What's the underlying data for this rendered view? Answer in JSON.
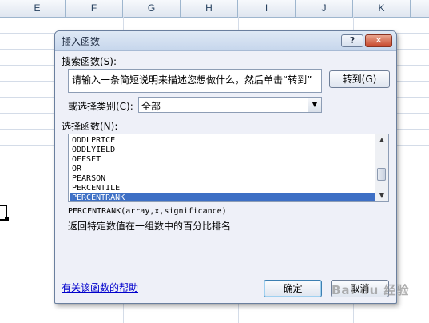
{
  "sheet": {
    "columns": [
      "E",
      "F",
      "G",
      "H",
      "I",
      "J",
      "K"
    ]
  },
  "dialog": {
    "title": "插入函数",
    "help_button": "?",
    "close_button": "✕",
    "search_label": "搜索函数(S):",
    "search_value": "请输入一条简短说明来描述您想做什么，然后单击“转到”",
    "go_button": "转到(G)",
    "category_label": "或选择类别(C):",
    "category_value": "全部",
    "function_list_label": "选择函数(N):",
    "functions": [
      "ODDLPRICE",
      "ODDLYIELD",
      "OFFSET",
      "OR",
      "PEARSON",
      "PERCENTILE",
      "PERCENTRANK"
    ],
    "selected_function": "PERCENTRANK",
    "syntax": "PERCENTRANK(array,x,significance)",
    "description": "返回特定数值在一组数中的百分比排名",
    "help_link": "有关该函数的帮助",
    "ok_button": "确定",
    "cancel_button": "取消"
  },
  "watermark": "Bai du 经验"
}
